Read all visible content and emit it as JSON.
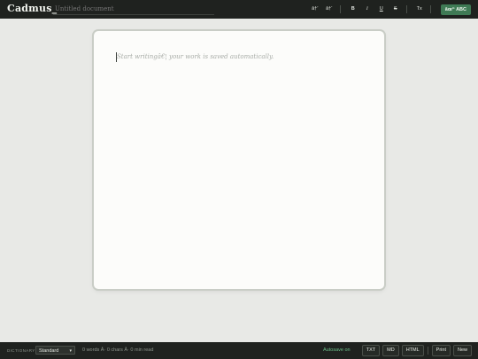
{
  "app": {
    "title": "Cadmus_"
  },
  "document": {
    "title_placeholder": "Untitled document",
    "title_value": ""
  },
  "toolbar": {
    "font_down": "â†’",
    "font_up": "â†‘",
    "bold": "B",
    "italic": "I",
    "underline": "U",
    "strike": "S",
    "clear_format": "Tx",
    "spellcheck": "âœ“ ABC"
  },
  "editor": {
    "placeholder": "Start writingâ€¦ your work is saved automatically."
  },
  "statusbar": {
    "dictionary_label": "DICTIONARY",
    "dictionary_value": "Standard",
    "counts": "0 words Â· 0 chars Â· 0 min read",
    "autosave": "Autosave on",
    "export_txt": "TXT",
    "export_md": "MD",
    "export_html": "HTML",
    "print": "Print",
    "new": "New"
  },
  "colors": {
    "bar": "#1f221f",
    "accent": "#3f7a55",
    "autosave": "#6cc08a",
    "page": "#fcfcfa",
    "background": "#e8e9e6"
  }
}
